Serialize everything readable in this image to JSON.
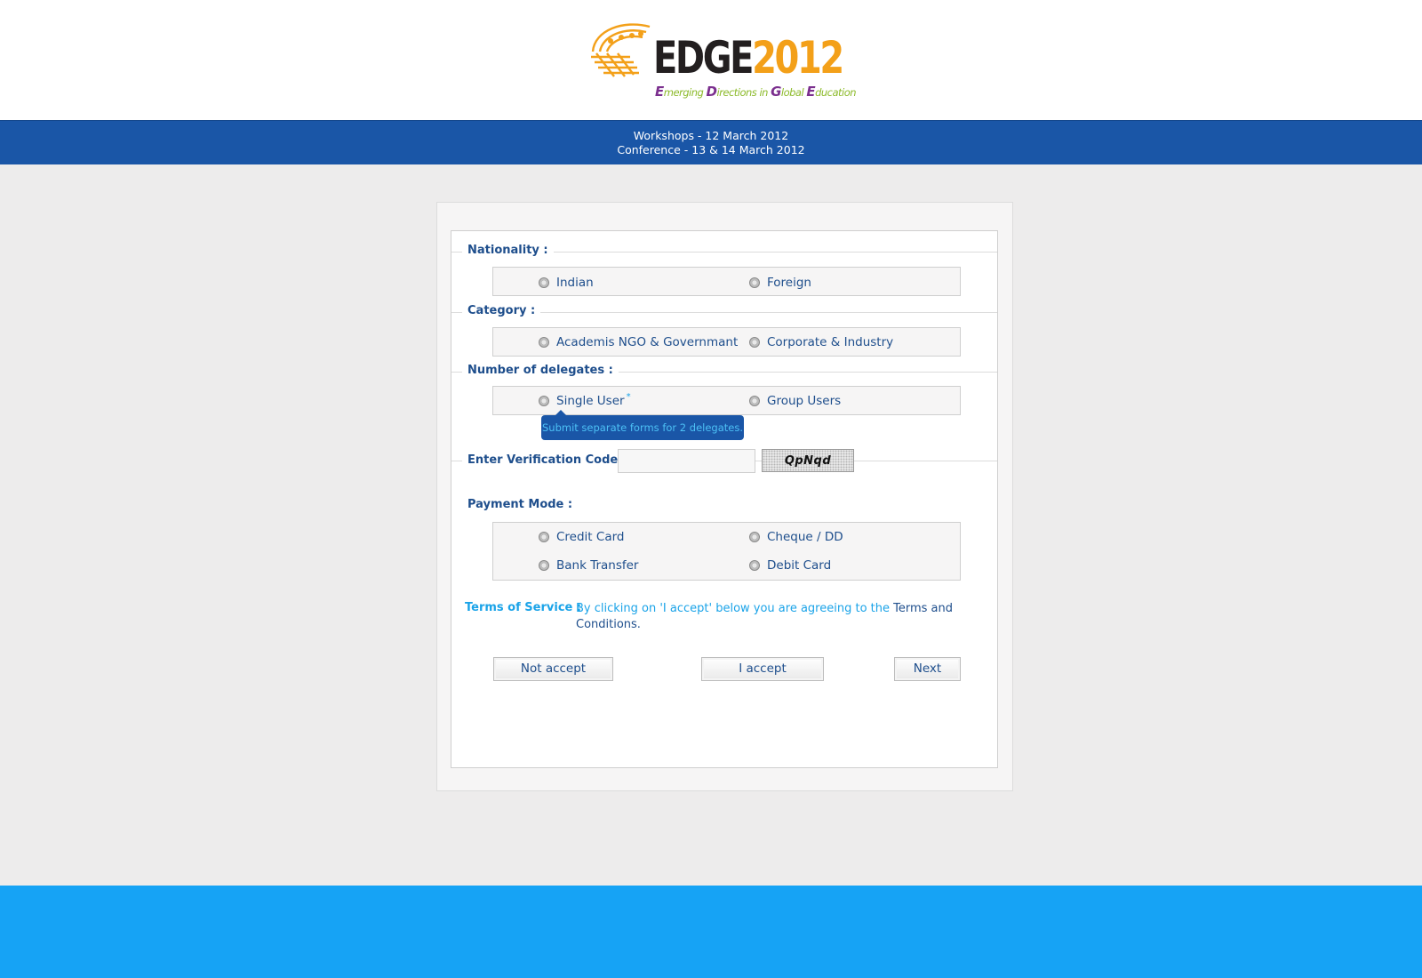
{
  "header": {
    "logo": {
      "wordmark_dark": "EDGE",
      "wordmark_accent": "2012",
      "tagline_parts": [
        {
          "cap": "E",
          "rest": "merging "
        },
        {
          "cap": "D",
          "rest": "irections in "
        },
        {
          "cap": "G",
          "rest": "lobal "
        },
        {
          "cap": "E",
          "rest": "ducation"
        }
      ]
    }
  },
  "banner": {
    "line1": "Workshops - 12 March 2012",
    "line2": "Conference - 13 & 14 March 2012"
  },
  "form": {
    "nationality": {
      "label": "Nationality :",
      "options": [
        "Indian",
        "Foreign"
      ]
    },
    "category": {
      "label": "Category :",
      "options": [
        "Academis NGO & Governmant",
        "Corporate & Industry"
      ]
    },
    "delegates": {
      "label": "Number of delegates :",
      "options": [
        "Single User",
        "Group Users"
      ],
      "required_mark": "*",
      "tooltip": "Submit separate forms for 2 delegates."
    },
    "verification": {
      "label": "Enter Verification Code :",
      "value": "",
      "captcha": "QpNqd"
    },
    "payment": {
      "label": "Payment Mode :",
      "options": [
        "Credit Card",
        "Cheque / DD",
        "Bank Transfer",
        "Debit Card"
      ]
    },
    "terms": {
      "label": "Terms of Service :",
      "text": "By clicking on 'I accept' below you are agreeing to the ",
      "link": "Terms and Conditions."
    },
    "buttons": {
      "not_accept": "Not accept",
      "accept": "I accept",
      "next": "Next"
    }
  },
  "colors": {
    "header_bg": "#ffffff",
    "banner_bg": "#1a56a7",
    "page_bg": "#edecec",
    "footer_bg": "#16a3f5",
    "label_text": "#1e4e8c",
    "accent_text": "#1aa3e8",
    "logo_orange": "#f3a019",
    "logo_purple": "#7b2f8e",
    "logo_green": "#8cba2a"
  }
}
